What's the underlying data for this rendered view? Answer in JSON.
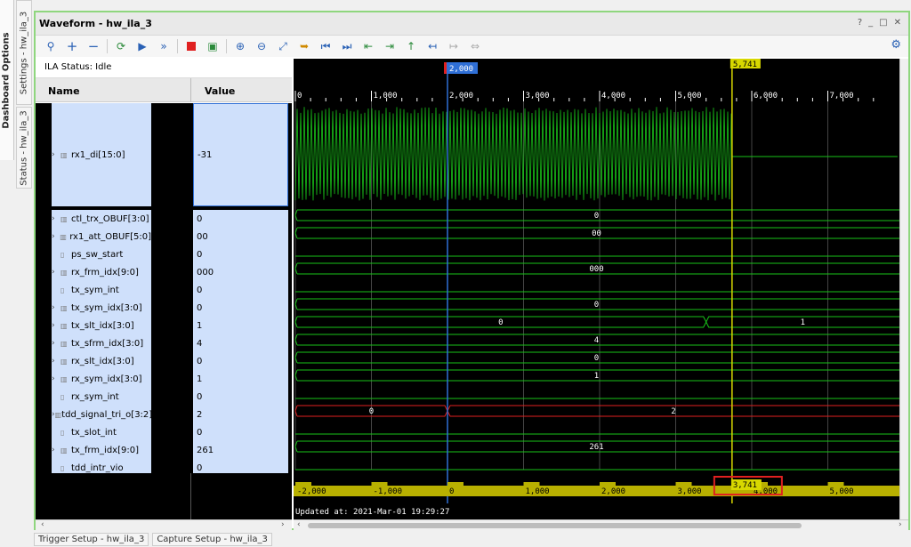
{
  "side_tabs": {
    "dashboard": "Dashboard Options",
    "settings": "Settings - hw_ila_3",
    "status": "Status - hw_ila_3"
  },
  "window": {
    "title": "Waveform - hw_ila_3",
    "controls": [
      "?",
      "_",
      "□",
      "✕"
    ]
  },
  "toolbar": {
    "icons": [
      "search-icon",
      "zoom-plus-icon",
      "zoom-minus-icon",
      "run-trigger-icon",
      "run-icon",
      "fast-forward-icon",
      "stop-icon",
      "export-icon",
      "zoom-in-icon",
      "zoom-out-icon",
      "zoom-fit-icon",
      "marker-add-icon",
      "go-first-icon",
      "go-last-icon",
      "prev-transition-icon",
      "next-transition-icon",
      "add-marker-icon",
      "prev-marker-icon",
      "next-marker-icon",
      "swap-cursors-icon"
    ]
  },
  "ila_status": "ILA Status:  Idle",
  "columns": {
    "name": "Name",
    "value": "Value"
  },
  "signals": [
    {
      "name": "rx1_di[15:0]",
      "value": "-31",
      "expandable": true
    },
    {
      "name": "ctl_trx_OBUF[3:0]",
      "value": "0",
      "expandable": true,
      "wave": "0"
    },
    {
      "name": "rx1_att_OBUF[5:0]",
      "value": "00",
      "expandable": true,
      "wave": "00"
    },
    {
      "name": "ps_sw_start",
      "value": "0",
      "expandable": false
    },
    {
      "name": "rx_frm_idx[9:0]",
      "value": "000",
      "expandable": true,
      "wave": "000"
    },
    {
      "name": "tx_sym_int",
      "value": "0",
      "expandable": false
    },
    {
      "name": "tx_sym_idx[3:0]",
      "value": "0",
      "expandable": true,
      "wave": "0"
    },
    {
      "name": "tx_slt_idx[3:0]",
      "value": "1",
      "expandable": true,
      "wave_a": "0",
      "wave_b": "1"
    },
    {
      "name": "tx_sfrm_idx[3:0]",
      "value": "4",
      "expandable": true,
      "wave": "4"
    },
    {
      "name": "rx_slt_idx[3:0]",
      "value": "0",
      "expandable": true,
      "wave": "0"
    },
    {
      "name": "rx_sym_idx[3:0]",
      "value": "1",
      "expandable": true,
      "wave": "1"
    },
    {
      "name": "rx_sym_int",
      "value": "0",
      "expandable": false
    },
    {
      "name": "tdd_signal_tri_o[3:2]",
      "value": "2",
      "expandable": true,
      "wave_a": "0",
      "wave_b": "2"
    },
    {
      "name": "tx_slot_int",
      "value": "0",
      "expandable": false
    },
    {
      "name": "tx_frm_idx[9:0]",
      "value": "261",
      "expandable": true,
      "wave": "261"
    },
    {
      "name": "tdd_intr_vio",
      "value": "0",
      "expandable": false
    }
  ],
  "timeline": {
    "cursor_blue": "2,000",
    "cursor_yellow": "5,741",
    "ticks": [
      "0",
      "1,000",
      "2,000",
      "3,000",
      "4,000",
      "5,000",
      "6,000",
      "7,000"
    ],
    "rel_ticks": [
      "-2,000",
      "-1,000",
      "0",
      "1,000",
      "2,000",
      "3,000",
      "4,000",
      "5,000"
    ],
    "delta": "3,741",
    "updated": "Updated at: 2021-Mar-01 19:29:27"
  },
  "bottom_tabs": [
    "Trigger Setup - hw_ila_3",
    "Capture Setup - hw_ila_3"
  ],
  "colors": {
    "wave": "#19c219",
    "highlight": "#cfe0fb",
    "cursor_yellow": "#d8d800",
    "cursor_blue": "#2f6fd6",
    "red": "#e02020"
  }
}
